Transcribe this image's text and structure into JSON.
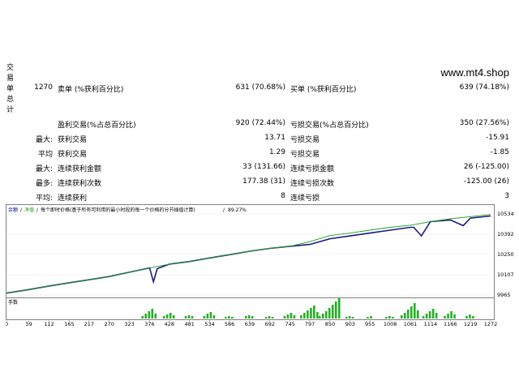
{
  "sidebar": {
    "label_chars": [
      "交",
      "易",
      "单",
      "总",
      "计"
    ]
  },
  "watermark": "www.mt4.shop",
  "stats": {
    "row1": {
      "count": "1270",
      "sell_label": "卖单 (%获利百分比)",
      "sell_value": "631 (70.68%)",
      "buy_label": "买单 (%获利百分比)",
      "buy_value": "639 (74.18%)"
    },
    "row2": {
      "profit_label": "盈利交易(%占总百分比)",
      "profit_value": "920 (72.44%)",
      "loss_label": "亏损交易(%占总百分比)",
      "loss_value": "350 (27.56%)"
    },
    "row3": {
      "prefix": "最大:",
      "profit_label": "获利交易",
      "profit_value": "13.71",
      "loss_label": "亏损交易",
      "loss_value": "-15.91"
    },
    "row4": {
      "prefix": "平均",
      "profit_label": "获利交易",
      "profit_value": "1.29",
      "loss_label": "亏损交易",
      "loss_value": "-1.85"
    },
    "row5": {
      "prefix": "最大:",
      "profit_label": "连续获利金额",
      "profit_value": "33 (131.66)",
      "loss_label": "连续亏损金额",
      "loss_value": "26 (-125.00)"
    },
    "row6": {
      "prefix": "最多:",
      "profit_label": "连续获利次数",
      "profit_value": "177.38 (31)",
      "loss_label": "连续亏损次数",
      "loss_value": "-125.00 (26)"
    },
    "row7": {
      "prefix": "平均:",
      "profit_label": "连续获利",
      "profit_value": "8",
      "loss_label": "连续亏损",
      "loss_value": "3"
    }
  },
  "chart_data": {
    "type": "line",
    "legend": {
      "balance": "余额",
      "equity": "净值",
      "note": "每个即时价格(基于所有可利用的最小时段的每一个价格的分节插值计算)",
      "quality": "89.27%"
    },
    "y_ticks": [
      "10534",
      "10392",
      "10250",
      "10107",
      "9965"
    ],
    "ylim": [
      9965,
      10534
    ],
    "volume_label": "手数",
    "x_ticks": [
      "0",
      "59",
      "112",
      "165",
      "217",
      "270",
      "323",
      "376",
      "428",
      "481",
      "534",
      "586",
      "639",
      "692",
      "745",
      "797",
      "850",
      "903",
      "955",
      "1008",
      "1061",
      "1114",
      "1166",
      "1219",
      "1272"
    ],
    "colors": {
      "balance": "#1a1a80",
      "equity": "#1e9e1e",
      "volume": "#22b022"
    },
    "series": [
      {
        "name": "余额",
        "x": [
          0,
          59,
          112,
          165,
          217,
          270,
          323,
          376,
          386,
          396,
          428,
          481,
          534,
          586,
          639,
          692,
          745,
          797,
          850,
          903,
          955,
          1008,
          1061,
          1070,
          1090,
          1114,
          1166,
          1200,
          1219,
          1272
        ],
        "values": [
          9978,
          10003,
          10028,
          10051,
          10072,
          10095,
          10125,
          10155,
          10058,
          10150,
          10182,
          10200,
          10225,
          10248,
          10272,
          10292,
          10307,
          10320,
          10360,
          10380,
          10400,
          10420,
          10440,
          10440,
          10380,
          10480,
          10492,
          10452,
          10505,
          10520
        ]
      },
      {
        "name": "净值",
        "x": [
          0,
          59,
          112,
          165,
          217,
          270,
          323,
          376,
          428,
          481,
          534,
          586,
          639,
          692,
          745,
          797,
          850,
          903,
          955,
          1008,
          1061,
          1114,
          1166,
          1219,
          1272
        ],
        "values": [
          9978,
          10003,
          10028,
          10051,
          10072,
          10095,
          10125,
          10155,
          10182,
          10200,
          10225,
          10248,
          10272,
          10292,
          10307,
          10340,
          10382,
          10400,
          10420,
          10440,
          10455,
          10480,
          10500,
          10515,
          10530
        ]
      }
    ]
  }
}
